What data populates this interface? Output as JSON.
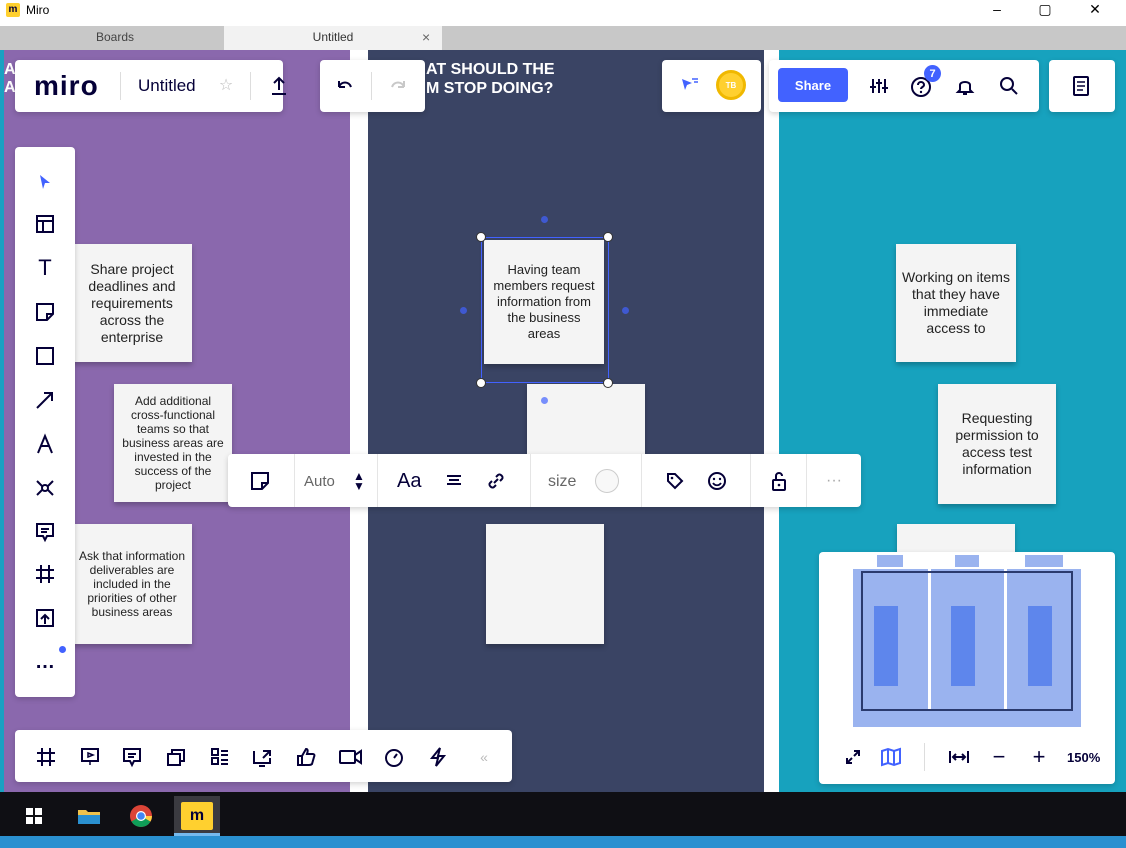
{
  "window": {
    "app_title": "Miro",
    "controls": {
      "minimize": "–",
      "maximize": "▢",
      "close": "✕"
    }
  },
  "tabs": [
    {
      "label": "Boards"
    },
    {
      "label": "Untitled",
      "close": "×"
    }
  ],
  "toolbar": {
    "logo": "miro",
    "board_name": "Untitled",
    "share_label": "Share",
    "notification_badge": "7",
    "avatar_initials": "TB"
  },
  "columns": {
    "left_heading_fragments": [
      "A",
      "A"
    ],
    "middle_heading_line1": "AT SHOULD THE",
    "middle_heading_line2": "M STOP DOING?"
  },
  "stickies": {
    "purple_1": "Share project deadlines and requirements across the enterprise",
    "purple_2": "Add additional cross-functional teams so that business areas are invested in the success of the project",
    "purple_3": "Ask that information deliverables are included in the priorities of other business areas",
    "navy_1": "Having team members request information from the business areas",
    "teal_1": "Working on items that they have immediate access to",
    "teal_2": "Requesting permission to access test information"
  },
  "context_toolbar": {
    "auto_label": "Auto",
    "font_label": "Aa",
    "size_label": "size"
  },
  "minimap": {
    "zoom_label": "150%"
  },
  "colors": {
    "purple": "#8a68ad",
    "navy": "#3a4464",
    "teal": "#17a2be",
    "accent": "#4262ff"
  }
}
